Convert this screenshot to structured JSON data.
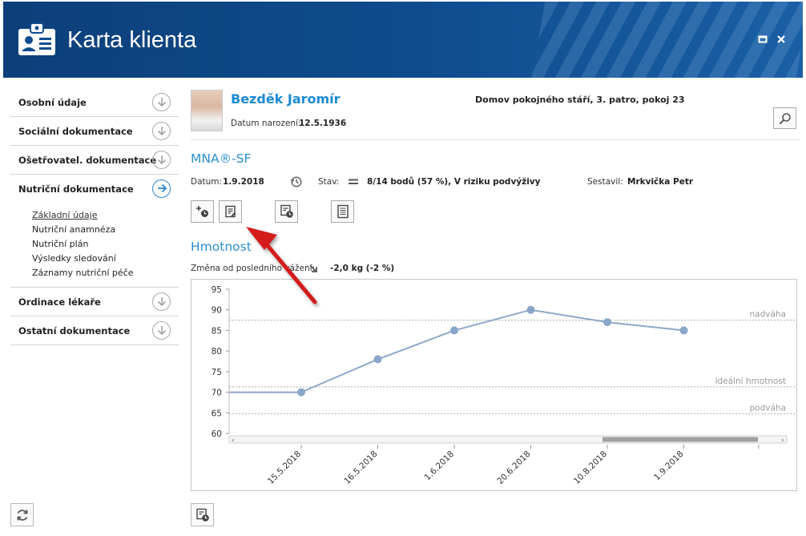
{
  "window": {
    "title": "Karta klienta",
    "maximize_icon": "maximize-icon",
    "close_icon": "close-icon"
  },
  "sidebar": {
    "sections": [
      {
        "label": "Osobní údaje",
        "icon": "chevron-down-icon"
      },
      {
        "label": "Sociální dokumentace",
        "icon": "chevron-down-icon"
      },
      {
        "label": "Ošetřovatel. dokumentace",
        "icon": "chevron-down-icon"
      },
      {
        "label": "Nutriční dokumentace",
        "icon": "arrow-right-icon"
      },
      {
        "label": "Ordinace lékaře",
        "icon": "chevron-down-icon"
      },
      {
        "label": "Ostatní dokumentace",
        "icon": "chevron-down-icon"
      }
    ],
    "subitems": [
      "Základní údaje",
      "Nutriční anamnéza",
      "Nutriční plán",
      "Výsledky sledování",
      "Záznamy nutriční péče"
    ]
  },
  "client": {
    "name": "Bezděk Jaromír",
    "dob_label": "Datum narození:",
    "dob": "12.5.1936",
    "address": "Domov pokojného stáří, 3. patro, pokoj 23"
  },
  "mna": {
    "title": "MNA®-SF",
    "date_label": "Datum:",
    "date": "1.9.2018",
    "status_label": "Stav:",
    "status": "8/14 bodů (57 %), V riziku podvýživy",
    "author_label": "Sestavil:",
    "author": "Mrkvička Petr"
  },
  "weight": {
    "title": "Hmotnost",
    "change_label": "Změna od posledního vážení:",
    "change_value": "-2,0 kg (-2 %)"
  },
  "chart_data": {
    "type": "line",
    "categories": [
      "15.5.2018",
      "16.5.2018",
      "1.6.2018",
      "20.6.2018",
      "10.8.2018",
      "1.9.2018"
    ],
    "values": [
      70,
      78,
      85,
      90,
      87,
      85
    ],
    "ylim": [
      60,
      95
    ],
    "yticks": [
      60,
      65,
      70,
      75,
      80,
      85,
      90,
      95
    ],
    "reference_lines": [
      {
        "label": "nadváha",
        "value": 87.5
      },
      {
        "label": "ideální hmotnost",
        "value": 71.3
      },
      {
        "label": "podváha",
        "value": 64.8
      }
    ],
    "series_color": "#8aa6c9",
    "line_color": "#8fa7c8"
  },
  "colors": {
    "header": "#0f4d8f",
    "accent": "#2b8fd1",
    "arrow": "#d41e1e"
  }
}
